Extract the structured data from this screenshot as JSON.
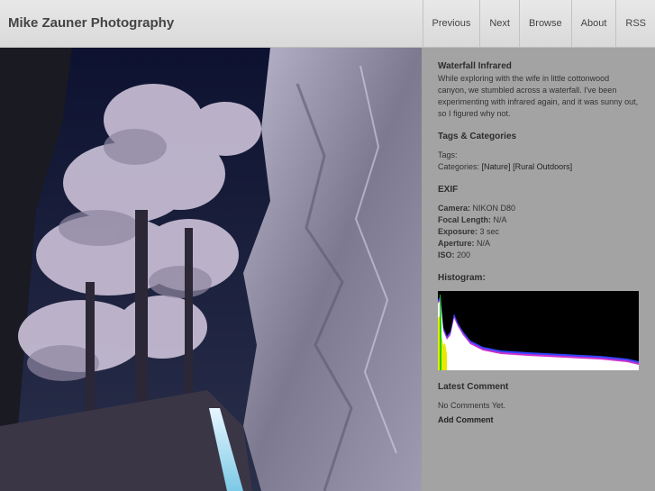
{
  "header": {
    "site_title": "Mike Zauner Photography",
    "nav": [
      "Previous",
      "Next",
      "Browse",
      "About",
      "RSS"
    ]
  },
  "photo": {
    "alt": "Infrared photograph of a waterfall in a canyon with frosted-looking trees"
  },
  "sidebar": {
    "title": "Waterfall Infrared",
    "description": "While exploring with the wife in little cottonwood canyon, we stumbled across a waterfall. I've been experimenting with infrared again, and it was sunny out, so I figured why not.",
    "tags_heading": "Tags & Categories",
    "tags_label": "Tags:",
    "categories_label": "Categories:",
    "categories": [
      "[Nature]",
      "[Rural Outdoors]"
    ],
    "exif_heading": "EXIF",
    "exif": {
      "camera_label": "Camera:",
      "camera": "NIKON D80",
      "focal_label": "Focal Length:",
      "focal": "N/A",
      "exposure_label": "Exposure:",
      "exposure": "3 sec",
      "aperture_label": "Aperture:",
      "aperture": "N/A",
      "iso_label": "ISO:",
      "iso": "200"
    },
    "histogram_heading": "Histogram:",
    "latest_comment_heading": "Latest Comment",
    "no_comments": "No Comments Yet.",
    "add_comment": "Add Comment"
  },
  "colors": {
    "header_bg": "#e0e0e0",
    "sidebar_bg": "#a3a3a3",
    "histogram_bg": "#000000"
  }
}
